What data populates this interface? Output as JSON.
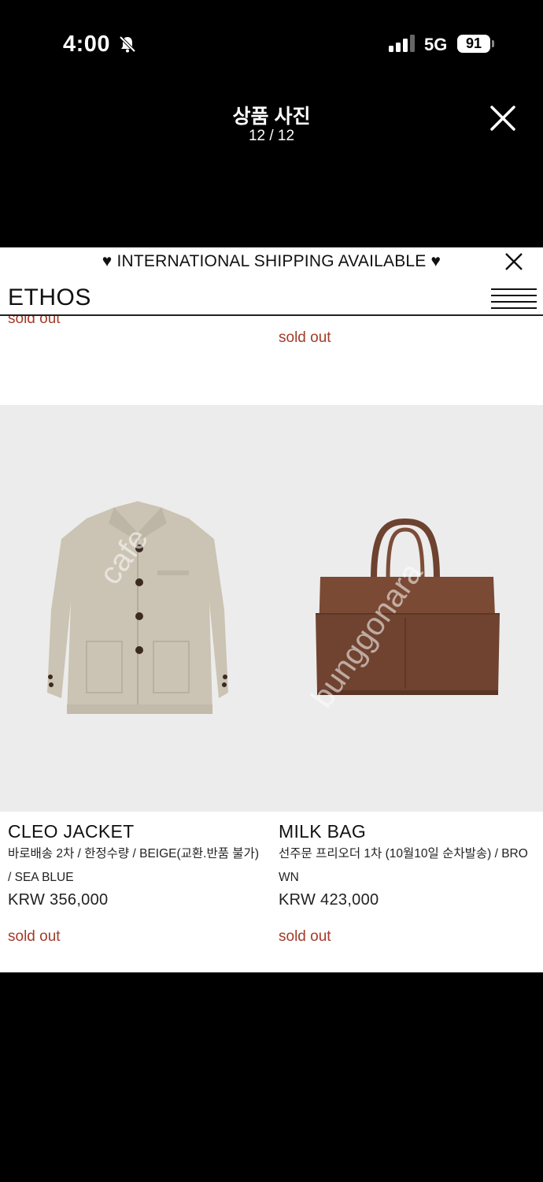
{
  "status_bar": {
    "time": "4:00",
    "network": "5G",
    "battery": "91"
  },
  "viewer": {
    "title": "상품 사진",
    "counter": "12 / 12"
  },
  "site": {
    "banner": "♥ INTERNATIONAL SHIPPING AVAILABLE ♥",
    "logo": "ETHOS",
    "partial_sold_out": "sold out",
    "top_sold_out": "sold out"
  },
  "products": [
    {
      "name": "CLEO JACKET",
      "desc_line1": "바로배송 2차 / 한정수량 / BEIGE(교환.반품 불가)",
      "desc_line2": "/ SEA BLUE",
      "price": "KRW 356,000",
      "status": "sold out"
    },
    {
      "name": "MILK BAG",
      "desc_line1": "선주문 프리오더 1차 (10월10일 순차발송) / BRO",
      "desc_line2": "WN",
      "price": "KRW 423,000",
      "status": "sold out"
    }
  ],
  "watermark": {
    "left": "cafe",
    "right": "bunggonara"
  },
  "colors": {
    "sold_out": "#a23c28",
    "jacket": "#cbc3b3",
    "bag": "#7a4a34",
    "gallery_bg": "#ececec"
  }
}
